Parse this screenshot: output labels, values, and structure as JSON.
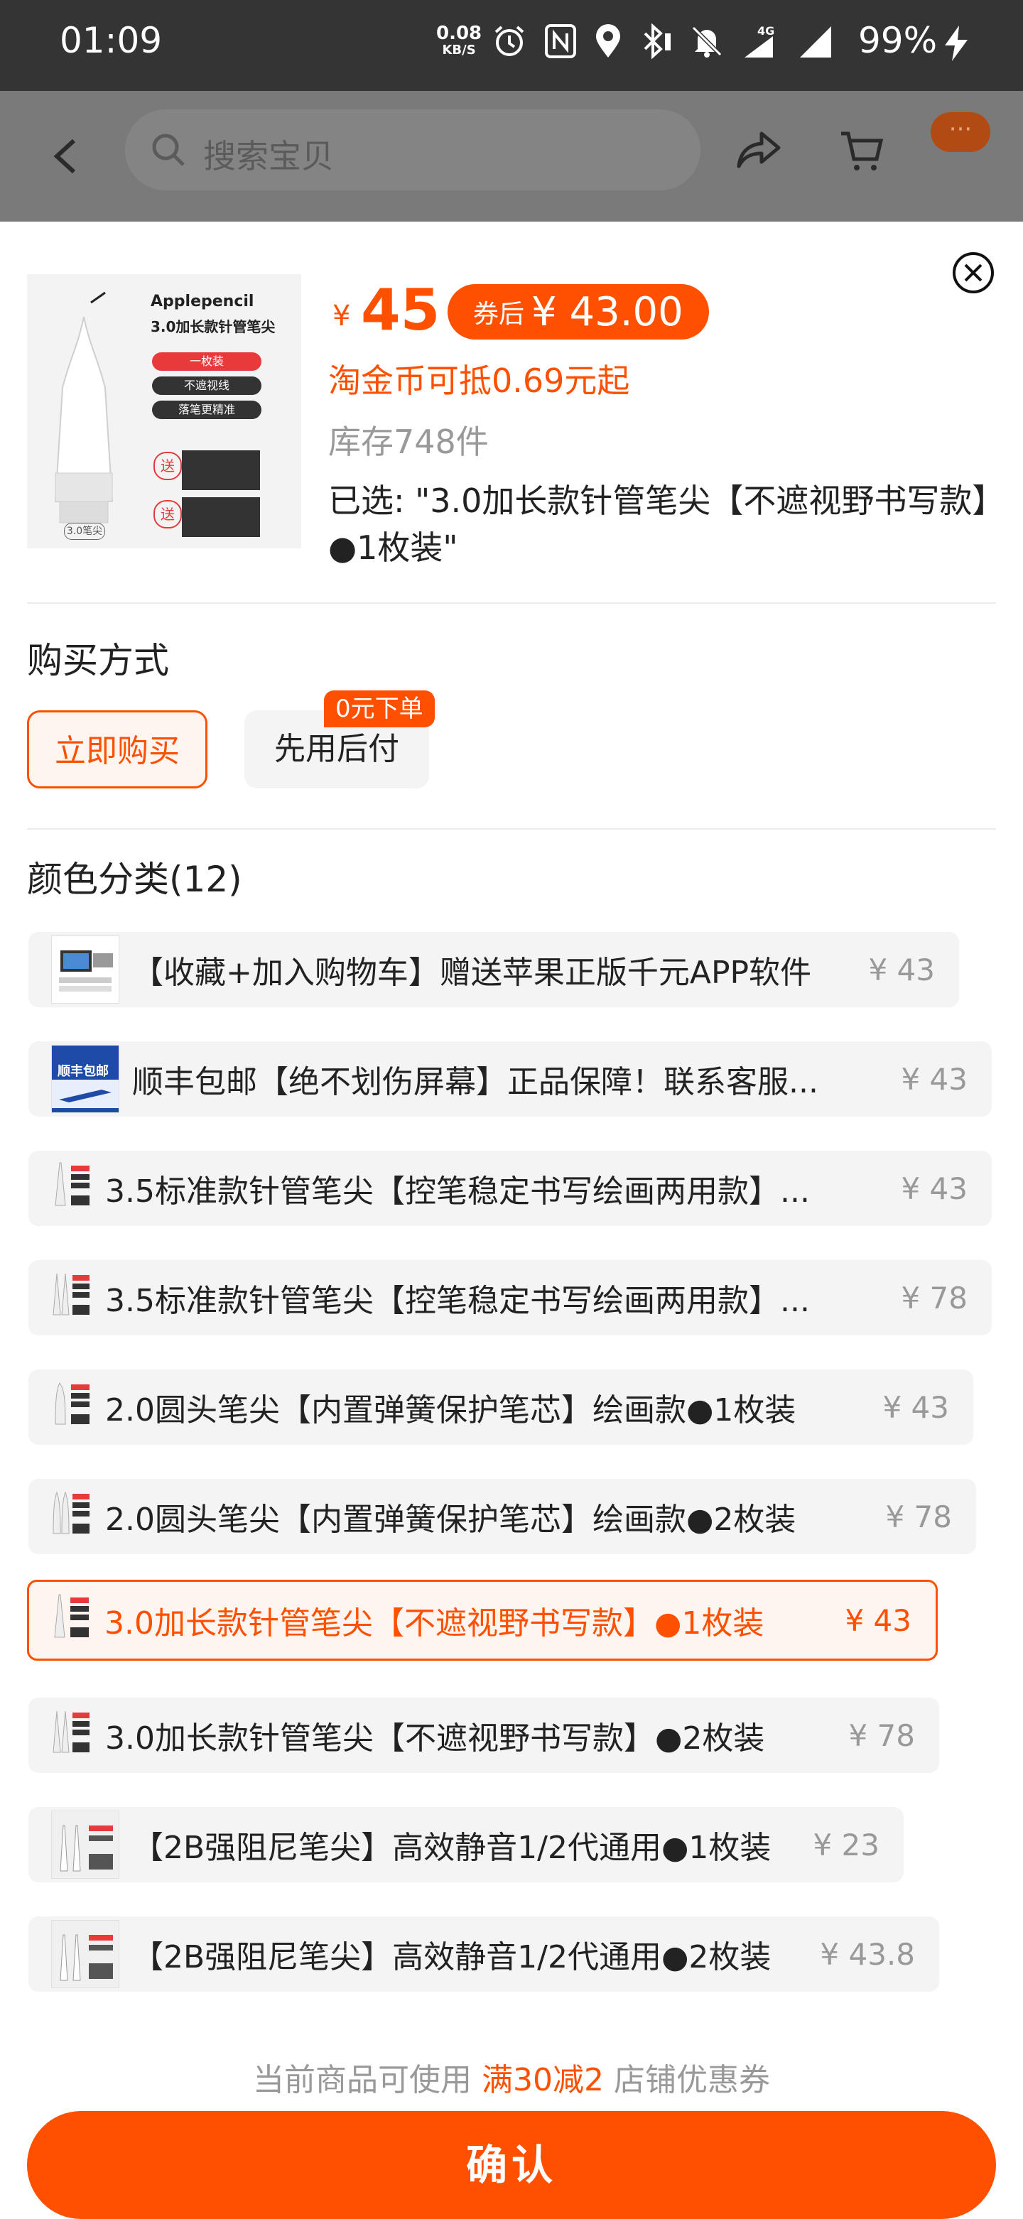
{
  "status_bar": {
    "time": "01:09",
    "net_speed_value": "0.08",
    "net_speed_unit": "KB/S",
    "network": "4G",
    "battery": "99%",
    "icons": [
      "alarm-icon",
      "nfc-icon",
      "location-icon",
      "bluetooth-icon",
      "mute-icon",
      "signal-4g-icon",
      "signal-icon",
      "charging-icon"
    ]
  },
  "nav": {
    "search_placeholder": "搜索宝贝",
    "more_label": "···"
  },
  "product": {
    "currency": "¥",
    "price": "45",
    "coupon_label": "券后",
    "coupon_price": "¥ 43.00",
    "taojin_note": "淘金币可抵0.69元起",
    "stock": "库存748件",
    "selected": "已选: \"3.0加长款针管笔尖【不遮视野书写款】●1枚装\"",
    "thumb_text": {
      "line1": "Applepencil",
      "line2": "3.0加长款针管笔尖",
      "tag1": "一枚装",
      "tag2": "不遮视线",
      "tag3": "落笔更精准",
      "gift": "送",
      "model": "3.0笔尖"
    }
  },
  "purchase": {
    "title": "购买方式",
    "buy_now": "立即购买",
    "pay_later": "先用后付",
    "pay_later_badge": "0元下单"
  },
  "variants": {
    "title": "颜色分类(12)",
    "items": [
      {
        "name": "【收藏+加入购物车】赠送苹果正版千元APP软件",
        "price": "¥ 43",
        "selected": false
      },
      {
        "name": "顺丰包邮【绝不划伤屏幕】正品保障！联系客服...",
        "price": "¥ 43",
        "selected": false
      },
      {
        "name": "3.5标准款针管笔尖【控笔稳定书写绘画两用款】...",
        "price": "¥ 43",
        "selected": false
      },
      {
        "name": "3.5标准款针管笔尖【控笔稳定书写绘画两用款】...",
        "price": "¥ 78",
        "selected": false
      },
      {
        "name": "2.0圆头笔尖【内置弹簧保护笔芯】绘画款●1枚装",
        "price": "¥ 43",
        "selected": false
      },
      {
        "name": "2.0圆头笔尖【内置弹簧保护笔芯】绘画款●2枚装",
        "price": "¥ 78",
        "selected": false
      },
      {
        "name": "3.0加长款针管笔尖【不遮视野书写款】●1枚装",
        "price": "¥ 43",
        "selected": true
      },
      {
        "name": "3.0加长款针管笔尖【不遮视野书写款】●2枚装",
        "price": "¥ 78",
        "selected": false
      },
      {
        "name": "【2B强阻尼笔尖】高效静音1/2代通用●1枚装",
        "price": "¥ 23",
        "selected": false
      },
      {
        "name": "【2B强阻尼笔尖】高效静音1/2代通用●2枚装",
        "price": "¥ 43.8",
        "selected": false
      }
    ],
    "sf_thumb_text": "顺丰包邮"
  },
  "footer": {
    "promo_prefix": "当前商品可使用",
    "promo_highlight": "满30减2",
    "promo_suffix": "店铺优惠券",
    "confirm": "确认"
  },
  "colors": {
    "accent": "#ff5000",
    "status_bar": "#343434",
    "overlay": "#7a7a7a"
  }
}
